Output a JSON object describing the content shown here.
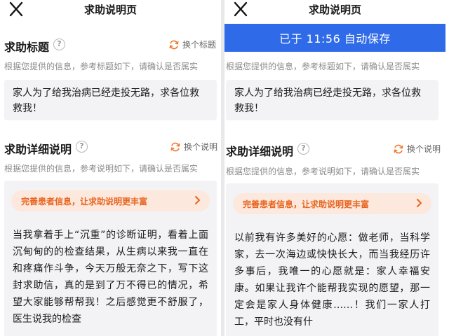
{
  "page_title": "求助说明页",
  "autosave_toast": "已于 11:56 自动保存",
  "title_section": {
    "heading": "求助标题",
    "help_glyph": "?",
    "swap_label": "换个标题",
    "hint": "根据您提供的信息，参考标题如下，请确认是否属实",
    "title_text": "家人为了给我治病已经走投无路，求各位救救我！"
  },
  "detail_section": {
    "heading": "求助详细说明",
    "help_glyph": "?",
    "swap_label": "换个说明",
    "hint": "根据您提供的信息，参考说明如下，请确认是否属实",
    "promo_text": "完善患者信息，让求助说明更丰富"
  },
  "left_story": "当我拿着手上“沉重”的诊断证明，看着上面沉甸甸的的检查结果，从生病以来我一直在和疼痛作斗争，今天万般无奈之下，写下这封求助信，真的是到了万不得已的情况，希望大家能够帮帮我！之后感觉更不舒服了，医生说我的检查",
  "right_story": "以前我有许多美好的心愿：做老师，当科学家，去一次海边或快快长大，而当我经历许多事后，我唯一的心愿就是：家人幸福安康。如果让我许个能帮我实现的愿望，那一定会是家人身体健康……！我们一家人打工，平时也没有什",
  "colors": {
    "accent_blue": "#2f6be9",
    "accent_orange": "#f07a2f",
    "promo_bg": "#fce8dc"
  },
  "icons": [
    "close-icon",
    "help-icon",
    "refresh-icon",
    "chevron-right-icon"
  ]
}
